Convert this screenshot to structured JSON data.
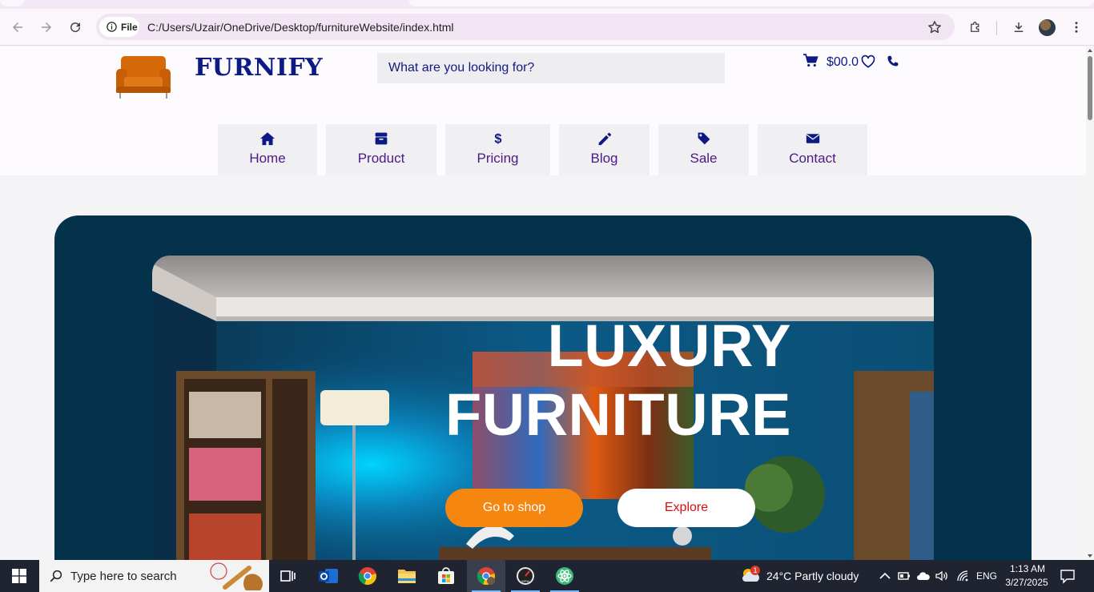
{
  "browser": {
    "chip_label": "File",
    "url": "C:/Users/Uzair/OneDrive/Desktop/furnitureWebsite/index.html"
  },
  "site": {
    "brand": "FURNIFY",
    "search_placeholder": "What are you looking for?",
    "cart_total": "$00.0",
    "nav": [
      {
        "label": "Home",
        "icon": "home-icon"
      },
      {
        "label": "Product",
        "icon": "box-icon"
      },
      {
        "label": "Pricing",
        "icon": "dollar-icon"
      },
      {
        "label": "Blog",
        "icon": "pencil-icon"
      },
      {
        "label": "Sale",
        "icon": "tag-icon"
      },
      {
        "label": "Contact",
        "icon": "envelope-icon"
      }
    ],
    "hero": {
      "title_line1": "LUXURY",
      "title_line2": "FURNITURE",
      "shop_button": "Go to shop",
      "explore_button": "Explore"
    }
  },
  "taskbar": {
    "search_placeholder": "Type here to search",
    "weather": "24°C  Partly cloudy",
    "weather_badge": "1",
    "language": "ENG",
    "time": "1:13 AM",
    "date": "3/27/2025"
  },
  "colors": {
    "brand_navy": "#0c1a86",
    "hero_bg": "#04324a",
    "shop_orange": "#f5860f",
    "explore_red": "#d61010"
  }
}
